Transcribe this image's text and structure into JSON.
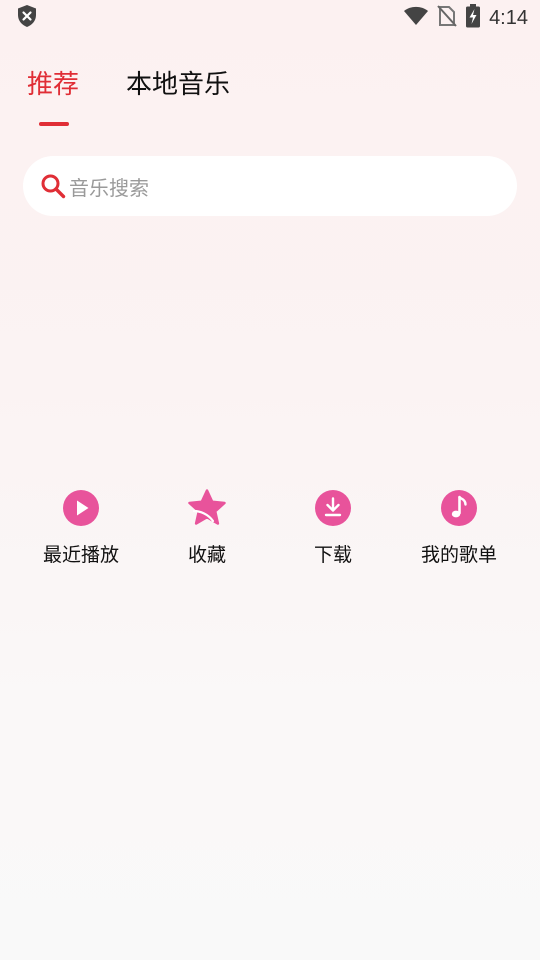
{
  "status_bar": {
    "time": "4:14",
    "icons": [
      "shield-x-icon",
      "wifi-icon",
      "no-sim-icon",
      "battery-charging-icon"
    ]
  },
  "tabs": [
    {
      "label": "推荐",
      "active": true
    },
    {
      "label": "本地音乐",
      "active": false
    }
  ],
  "search": {
    "placeholder": "音乐搜索",
    "icon": "search-icon"
  },
  "shortcuts": [
    {
      "label": "最近播放",
      "icon": "play-circle-icon"
    },
    {
      "label": "收藏",
      "icon": "star-icon"
    },
    {
      "label": "下载",
      "icon": "download-icon"
    },
    {
      "label": "我的歌单",
      "icon": "music-note-icon"
    }
  ],
  "colors": {
    "accent": "#e02e36",
    "icon_pink": "#e8539b",
    "background": "#fcf1f1"
  }
}
